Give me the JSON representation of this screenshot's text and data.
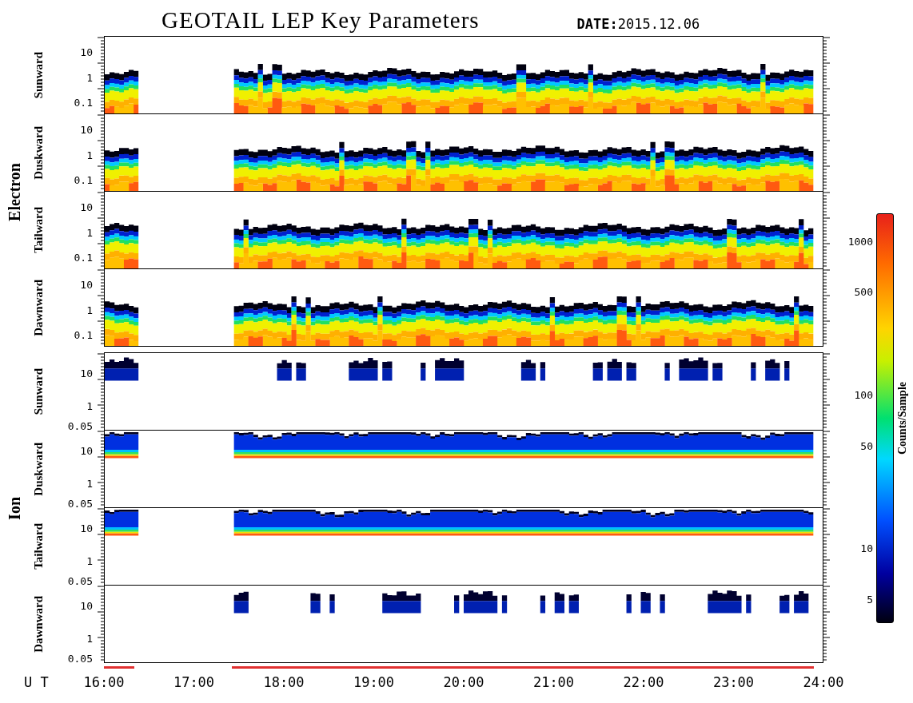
{
  "title": "GEOTAIL LEP Key Parameters",
  "date_label": "DATE:",
  "date": "2015.12.06",
  "groups": [
    {
      "label": "Electron",
      "panels": [
        {
          "label": "Sunward",
          "kind": "electron",
          "yticks": [
            "10",
            "1",
            "0.1"
          ]
        },
        {
          "label": "Duskward",
          "kind": "electron",
          "yticks": [
            "10",
            "1",
            "0.1"
          ]
        },
        {
          "label": "Tailward",
          "kind": "electron",
          "yticks": [
            "10",
            "1",
            "0.1"
          ]
        },
        {
          "label": "Dawnward",
          "kind": "electron",
          "yticks": [
            "10",
            "1",
            "0.1"
          ]
        }
      ]
    },
    {
      "label": "Ion",
      "panels": [
        {
          "label": "Sunward",
          "kind": "ion-sparse",
          "yticks": [
            "10",
            "1",
            "0.05"
          ]
        },
        {
          "label": "Duskward",
          "kind": "ion-dense",
          "yticks": [
            "10",
            "1",
            "0.05"
          ]
        },
        {
          "label": "Tailward",
          "kind": "ion-dense",
          "yticks": [
            "10",
            "1",
            "0.05"
          ]
        },
        {
          "label": "Dawnward",
          "kind": "ion-sparse",
          "yticks": [
            "10",
            "1",
            "0.05"
          ]
        }
      ]
    }
  ],
  "x_axis": {
    "label": "U T",
    "ticks": [
      "16:00",
      "17:00",
      "18:00",
      "19:00",
      "20:00",
      "21:00",
      "22:00",
      "23:00",
      "24:00"
    ]
  },
  "colorbar": {
    "label": "Counts/Sample",
    "ticks": [
      "1000",
      "500",
      "100",
      "50",
      "10",
      "5"
    ]
  }
}
